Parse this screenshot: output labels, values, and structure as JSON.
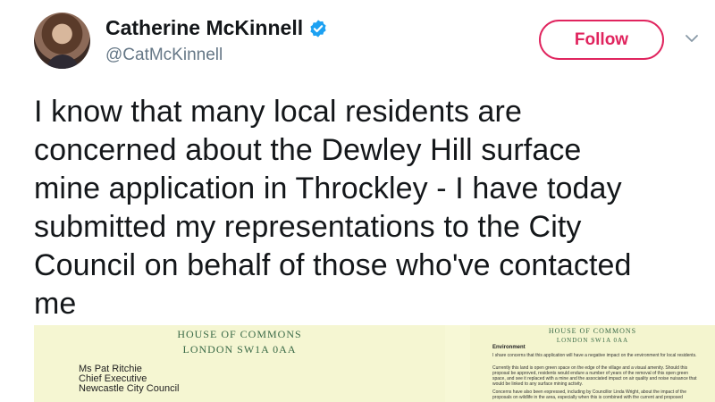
{
  "user": {
    "display_name": "Catherine McKinnell",
    "handle": "@CatMcKinnell",
    "verified": true
  },
  "actions": {
    "follow_label": "Follow",
    "more_icon": "chevron-down-icon"
  },
  "tweet": {
    "lines": [
      "I know that many local residents are",
      "concerned about the Dewley Hill surface",
      "mine application in Throckley - I have today",
      "submitted my representations to the City",
      "Council on behalf of those who've contacted",
      "me"
    ]
  },
  "media": {
    "left_page": {
      "letterhead_1": "HOUSE OF COMMONS",
      "letterhead_2": "LONDON SW1A 0AA",
      "address": [
        "Ms Pat Ritchie",
        "Chief Executive",
        "Newcastle City Council"
      ]
    },
    "right_page": {
      "letterhead_1": "HOUSE OF COMMONS",
      "letterhead_2": "LONDON SW1A 0AA",
      "heading": "Environment",
      "paragraphs": [
        "I share concerns that this application will have a negative impact on the environment for local residents.",
        "Currently this land is open green space on the edge of the village and a visual amenity. Should this proposal be approved, residents would endure a number of years of the removal of this open green space, and see it replaced with a mine and the associated impact on air quality and noise nuisance that would be linked to any surface mining activity.",
        "Concerns have also been expressed, including by Councillor Linda Wright, about the impact of the proposals on wildlife in the area, especially when this is combined with the current and proposed"
      ]
    }
  },
  "colors": {
    "follow": "#e0245e",
    "verified": "#1da1f2",
    "handle": "#657786",
    "text": "#14171a"
  }
}
